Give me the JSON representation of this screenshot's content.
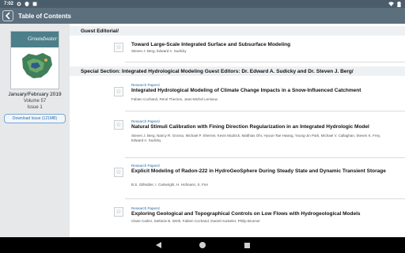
{
  "status": {
    "time": "7:02",
    "icons": [
      "settings-icon",
      "shield-icon",
      "notification-icon"
    ],
    "right_icons": [
      "wifi-icon",
      "battery-icon"
    ]
  },
  "appbar": {
    "title": "Table of Contents",
    "back_icon": "chevron-left-icon"
  },
  "sidebar": {
    "cover_title": "Groundwater",
    "issue_date": "January/February 2019",
    "volume": "Volume 57",
    "issue": "Issue 1",
    "download_label": "Download Issue (121MB)"
  },
  "sections": [
    {
      "heading": "Guest Editorial/"
    },
    {
      "heading": "Special Section: Integrated Hydrological Modeling Guest Editors: Dr. Edward A. Sudicky and Dr. Steven J. Berg/"
    }
  ],
  "articles": [
    {
      "category": "",
      "title": "Toward Large-Scale Integrated Surface and Subsurface Modeling",
      "authors": "Steven J. Berg, Edward A. Sudicky"
    },
    {
      "category": "Research Papers/",
      "title": "Integrated Hydrological Modeling of Climate Change Impacts in a Snow-Influenced Catchment",
      "authors": "Fabien Cochand, René Therrien, Jean-Michel Lemieux"
    },
    {
      "category": "Research Papers/",
      "title": "Natural Stimuli Calibration with Fining Direction Regularization in an Integrated Hydrologic Model",
      "authors": "Steven J. Berg, Nancy R. Grosso, Michael P. Sherner, Kevin Mudrick, Matthias Ohr, Hyoun-Tae Hwang, Young-Jin Park, Michael V. Callaghan, Steven K. Frey, Edward A. Sudicky"
    },
    {
      "category": "Research Papers/",
      "title": "Explicit Modeling of Radon-222 in HydroGeoSphere During Steady State and Dynamic Transient Storage",
      "authors": "B.S. Gilfedder, I. Cartwright, H. Hofmann, S. Frei"
    },
    {
      "category": "Research Papers/",
      "title": "Exploring Geological and Topographical Controls on Low Flows with Hydrogeological Models",
      "authors": "Claire Carlier, Stefanie B. Wirth, Fabien Cochand, Daniel Hunkeler, Philip Brunner"
    }
  ],
  "colors": {
    "status_bar": "#4b5d6b",
    "app_bar": "#5b6f7d",
    "sidebar": "#e6e8ea",
    "link": "#2b6aa8",
    "nav_bar": "#000000"
  },
  "navbar": {
    "icons": [
      "back-triangle-icon",
      "home-circle-icon",
      "recents-square-icon"
    ]
  }
}
